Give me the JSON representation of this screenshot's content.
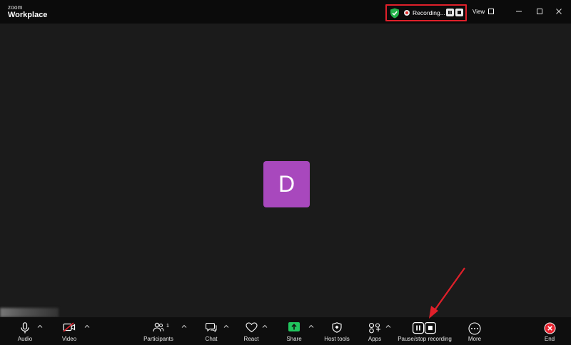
{
  "app": {
    "logo_top": "zoom",
    "logo_bottom": "Workplace"
  },
  "recording": {
    "status": "Recording..."
  },
  "header": {
    "view_label": "View"
  },
  "participant": {
    "initial": "D"
  },
  "toolbar": {
    "audio": "Audio",
    "video": "Video",
    "participants": "Participants",
    "participants_count": "1",
    "chat": "Chat",
    "react": "React",
    "share": "Share",
    "host_tools": "Host tools",
    "apps": "Apps",
    "pause_stop": "Pause/stop recording",
    "more": "More",
    "end": "End"
  },
  "colors": {
    "recording_outline": "#e0202a",
    "avatar": "#a848bd",
    "share_green": "#21c55d",
    "end_red": "#e5232f",
    "annotation_arrow": "#e0202a"
  }
}
